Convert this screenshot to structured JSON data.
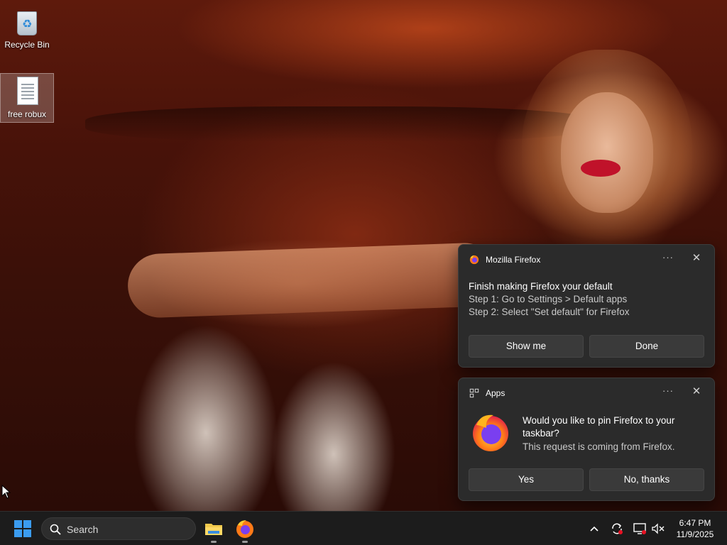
{
  "desktop": {
    "icons": [
      {
        "label": "Recycle Bin",
        "icon": "recycle-bin-icon"
      },
      {
        "label": "free robux",
        "icon": "text-file-icon"
      }
    ]
  },
  "notifications": [
    {
      "app_name": "Mozilla Firefox",
      "app_icon": "firefox-icon",
      "title": "Finish making Firefox your default",
      "lines": [
        "Step 1: Go to Settings > Default apps",
        "Step 2: Select \"Set default\" for Firefox"
      ],
      "buttons": [
        "Show me",
        "Done"
      ],
      "more_glyph": "···",
      "close_glyph": "✕"
    },
    {
      "app_name": "Apps",
      "app_icon": "apps-icon",
      "title": "Would you like to pin Firefox to your taskbar?",
      "lines": [
        "This request is coming from Firefox."
      ],
      "buttons": [
        "Yes",
        "No, thanks"
      ],
      "more_glyph": "···",
      "close_glyph": "✕"
    }
  ],
  "taskbar": {
    "search_label": "Search",
    "apps": [
      "file-explorer-icon",
      "firefox-icon"
    ],
    "tray": [
      "chevron-up-icon",
      "sync-icon",
      "network-icon",
      "volume-muted-icon"
    ],
    "time": "6:47 PM",
    "date": "11/9/2025"
  },
  "colors": {
    "toast_bg": "#2b2b2b",
    "taskbar_bg": "#1c1c1c",
    "windows_blue": "#3b9cf0",
    "firefox_orange": "#ff7a18",
    "firefox_purple": "#7a3ff0"
  }
}
